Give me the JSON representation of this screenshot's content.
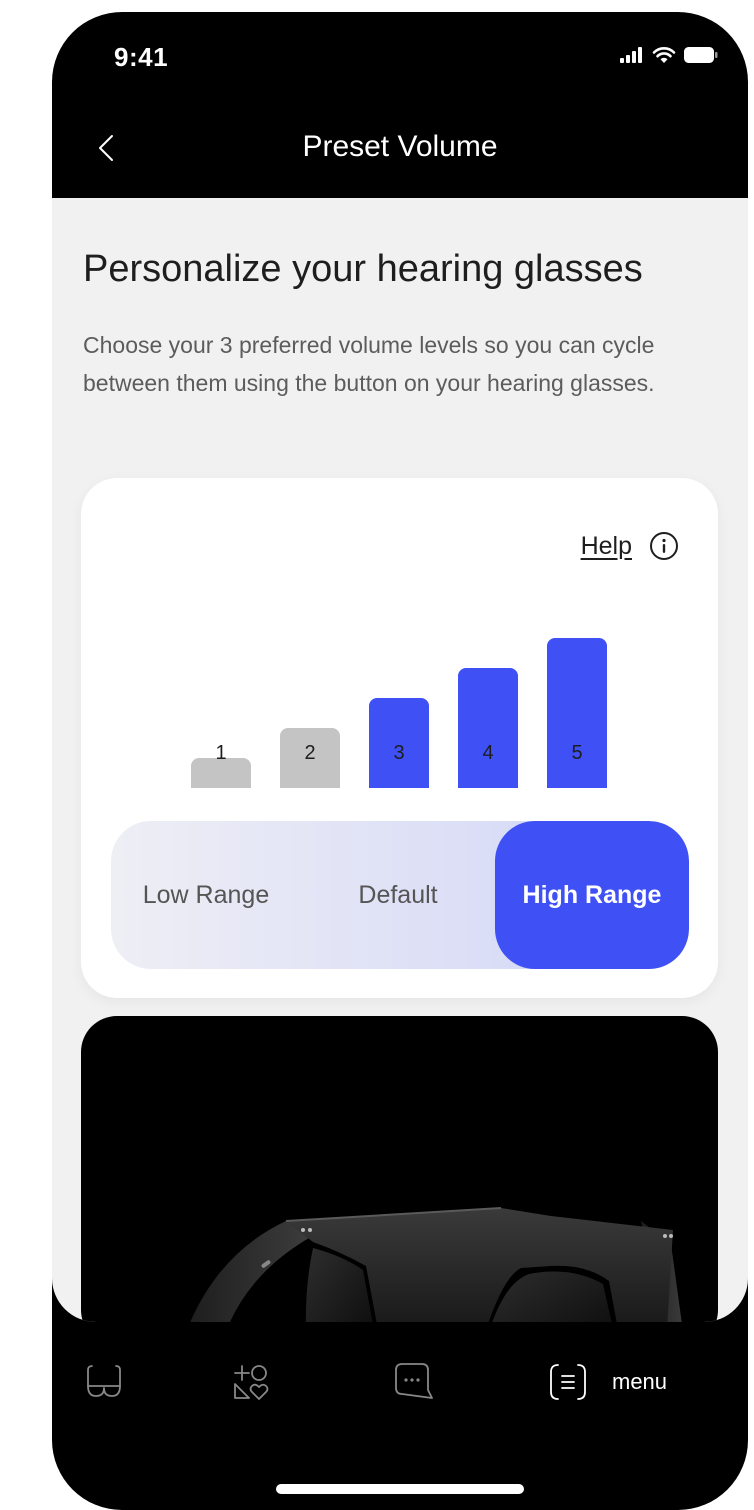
{
  "status_bar": {
    "time": "9:41"
  },
  "nav": {
    "title": "Preset Volume"
  },
  "page": {
    "heading": "Personalize your hearing glasses",
    "description": "Choose your 3 preferred volume levels so you can cycle between them using the button on your hearing glasses."
  },
  "volume_card": {
    "help_label": "Help",
    "levels": [
      {
        "label": "1",
        "active": false
      },
      {
        "label": "2",
        "active": false
      },
      {
        "label": "3",
        "active": true
      },
      {
        "label": "4",
        "active": true
      },
      {
        "label": "5",
        "active": true
      }
    ],
    "ranges": [
      {
        "label": "Low Range",
        "selected": false
      },
      {
        "label": "Default",
        "selected": false
      },
      {
        "label": "High Range",
        "selected": true
      }
    ]
  },
  "tab_bar": {
    "items": [
      {
        "icon": "glasses-icon"
      },
      {
        "icon": "apps-icon"
      },
      {
        "icon": "chat-icon"
      },
      {
        "icon": "menu-icon",
        "label": "menu"
      }
    ]
  },
  "colors": {
    "accent": "#3f51f5",
    "inactive_bar": "#c4c4c4",
    "background": "#f1f1f1"
  }
}
